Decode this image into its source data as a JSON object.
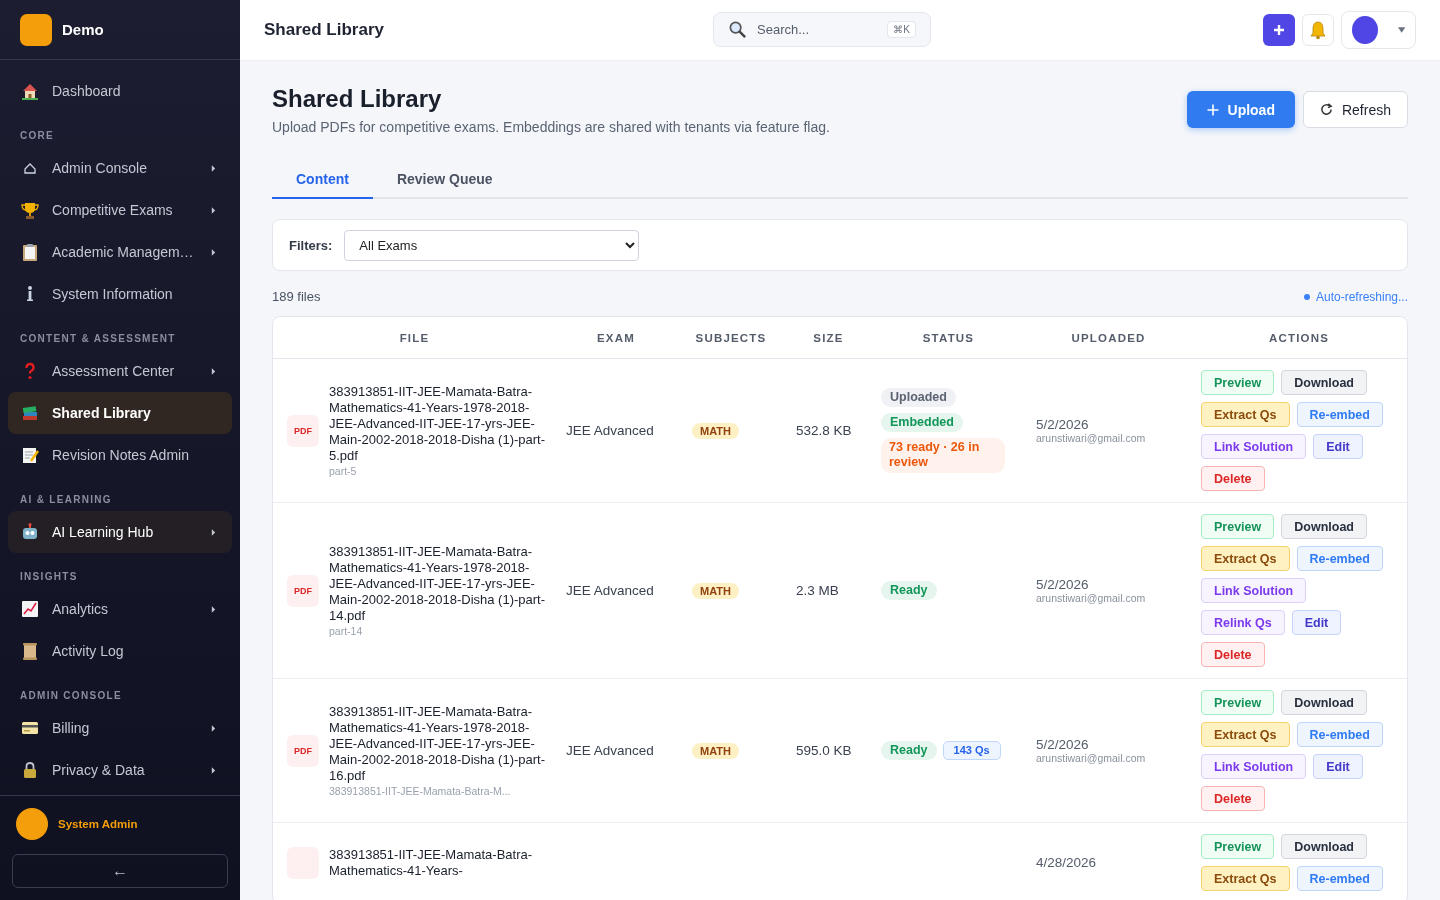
{
  "brand": {
    "name": "Demo"
  },
  "sidebar": {
    "sections": [
      {
        "items": [
          {
            "label": "Dashboard",
            "has_submenu": false,
            "selected": false,
            "hovered": false
          }
        ]
      },
      {
        "title": "CORE",
        "items": [
          {
            "label": "Admin Console",
            "has_submenu": true,
            "selected": false,
            "hovered": false
          },
          {
            "label": "Competitive Exams",
            "has_submenu": true,
            "selected": false,
            "hovered": false
          },
          {
            "label": "Academic Managem…",
            "has_submenu": true,
            "selected": false,
            "hovered": false
          },
          {
            "label": "System Information",
            "has_submenu": false,
            "selected": false,
            "hovered": false
          }
        ]
      },
      {
        "title": "CONTENT & ASSESSMENT",
        "items": [
          {
            "label": "Assessment Center",
            "has_submenu": true,
            "selected": false,
            "hovered": false
          },
          {
            "label": "Shared Library",
            "has_submenu": false,
            "selected": true,
            "hovered": false
          },
          {
            "label": "Revision Notes Admin",
            "has_submenu": false,
            "selected": false,
            "hovered": false
          }
        ]
      },
      {
        "title": "AI & LEARNING",
        "items": [
          {
            "label": "AI Learning Hub",
            "has_submenu": true,
            "selected": false,
            "hovered": true
          }
        ]
      },
      {
        "title": "INSIGHTS",
        "items": [
          {
            "label": "Analytics",
            "has_submenu": true,
            "selected": false,
            "hovered": false
          },
          {
            "label": "Activity Log",
            "has_submenu": false,
            "selected": false,
            "hovered": false
          }
        ]
      },
      {
        "title": "ADMIN CONSOLE",
        "items": [
          {
            "label": "Billing",
            "has_submenu": true,
            "selected": false,
            "hovered": false
          },
          {
            "label": "Privacy & Data",
            "has_submenu": true,
            "selected": false,
            "hovered": false
          }
        ]
      }
    ],
    "user": {
      "name": "System Admin"
    },
    "collapse_button": "←"
  },
  "topbar": {
    "title": "Shared Library",
    "search": {
      "placeholder": "Search...",
      "shortcut": "⌘K"
    }
  },
  "page": {
    "title": "Shared Library",
    "subtitle": "Upload PDFs for competitive exams. Embeddings are shared with tenants via feature flag.",
    "buttons": [
      {
        "label": "Upload",
        "kind": "primary"
      },
      {
        "label": "Refresh",
        "kind": "secondary"
      }
    ]
  },
  "tabs": [
    {
      "label": "Content",
      "selected": true
    },
    {
      "label": "Review Queue",
      "selected": false
    }
  ],
  "filters": {
    "label": "Filters:",
    "exam": "All Exams"
  },
  "file_count": "189 files",
  "auto_refresh": "Auto-refreshing...",
  "table": {
    "columns": [
      "FILE",
      "EXAM",
      "SUBJECTS",
      "SIZE",
      "STATUS",
      "UPLOADED",
      "ACTIONS"
    ],
    "rows": [
      {
        "type": "PDF",
        "name": "383913851-IIT-JEE-Mamata-Batra-Mathematics-41-Years-1978-2018-JEE-Advanced-IIT-JEE-17-yrs-JEE-Main-2002-2018-2018-Disha (1)-part-5.pdf",
        "sub": "part-5",
        "exam": "JEE Advanced",
        "subject": "MATH",
        "size": "532.8 KB",
        "status": [
          {
            "kind": "uploaded",
            "label": "Uploaded"
          },
          {
            "kind": "embedded",
            "label": "Embedded"
          },
          {
            "kind": "review",
            "label": "73 ready · 26 in review"
          }
        ],
        "date": "5/2/2026",
        "uploader": "arunstiwari@gmail.com",
        "actions": [
          {
            "kind": "preview",
            "label": "Preview"
          },
          {
            "kind": "download",
            "label": "Download"
          },
          {
            "kind": "extract",
            "label": "Extract Qs"
          },
          {
            "kind": "reembed",
            "label": "Re-embed"
          },
          {
            "kind": "link",
            "label": "Link Solution"
          },
          {
            "kind": "edit",
            "label": "Edit"
          },
          {
            "kind": "delete",
            "label": "Delete"
          }
        ]
      },
      {
        "type": "PDF",
        "name": "383913851-IIT-JEE-Mamata-Batra-Mathematics-41-Years-1978-2018-JEE-Advanced-IIT-JEE-17-yrs-JEE-Main-2002-2018-2018-Disha (1)-part-14.pdf",
        "sub": "part-14",
        "exam": "JEE Advanced",
        "subject": "MATH",
        "size": "2.3 MB",
        "status": [
          {
            "kind": "ready",
            "label": "Ready"
          }
        ],
        "date": "5/2/2026",
        "uploader": "arunstiwari@gmail.com",
        "actions": [
          {
            "kind": "preview",
            "label": "Preview"
          },
          {
            "kind": "download",
            "label": "Download"
          },
          {
            "kind": "extract",
            "label": "Extract Qs"
          },
          {
            "kind": "reembed",
            "label": "Re-embed"
          },
          {
            "kind": "link",
            "label": "Link Solution"
          },
          {
            "kind": "relink",
            "label": "Relink Qs"
          },
          {
            "kind": "edit",
            "label": "Edit"
          },
          {
            "kind": "delete",
            "label": "Delete"
          }
        ]
      },
      {
        "type": "PDF",
        "name": "383913851-IIT-JEE-Mamata-Batra-Mathematics-41-Years-1978-2018-JEE-Advanced-IIT-JEE-17-yrs-JEE-Main-2002-2018-2018-Disha (1)-part-16.pdf",
        "sub": "383913851-IIT-JEE-Mamata-Batra-M...",
        "exam": "JEE Advanced",
        "subject": "MATH",
        "size": "595.0 KB",
        "status": [
          {
            "kind": "ready",
            "label": "Ready"
          },
          {
            "kind": "count",
            "label": "143 Qs"
          }
        ],
        "date": "5/2/2026",
        "uploader": "arunstiwari@gmail.com",
        "actions": [
          {
            "kind": "preview",
            "label": "Preview"
          },
          {
            "kind": "download",
            "label": "Download"
          },
          {
            "kind": "extract",
            "label": "Extract Qs"
          },
          {
            "kind": "reembed",
            "label": "Re-embed"
          },
          {
            "kind": "link",
            "label": "Link Solution"
          },
          {
            "kind": "edit",
            "label": "Edit"
          },
          {
            "kind": "delete",
            "label": "Delete"
          }
        ]
      },
      {
        "name": "383913851-IIT-JEE-Mamata-Batra-Mathematics-41-Years-",
        "date": "4/28/2026",
        "status": [],
        "actions": [
          {
            "kind": "preview",
            "label": "Preview"
          },
          {
            "kind": "download",
            "label": "Download"
          },
          {
            "kind": "extract",
            "label": "Extract Qs"
          },
          {
            "kind": "reembed",
            "label": "Re-embed"
          }
        ]
      }
    ]
  }
}
